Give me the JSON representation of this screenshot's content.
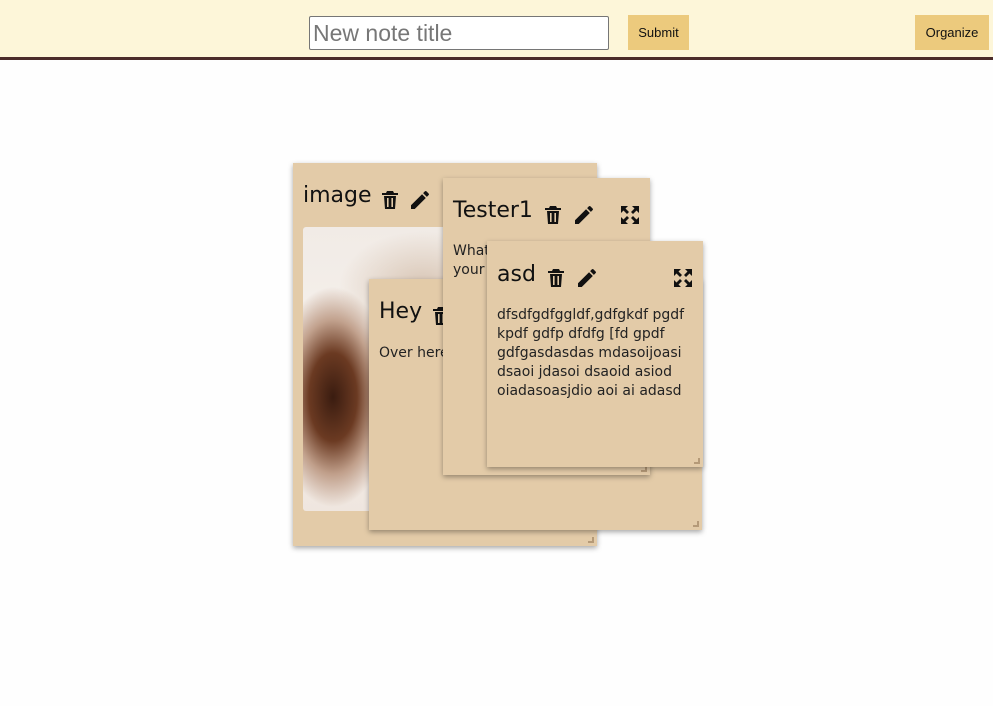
{
  "header": {
    "title_placeholder": "New note title",
    "submit_label": "Submit",
    "organize_label": "Organize"
  },
  "notes": [
    {
      "title": "image",
      "body": ""
    },
    {
      "title": "Hey",
      "body": "Over here"
    },
    {
      "title": "Tester1",
      "body": "What your"
    },
    {
      "title": "asd",
      "body": "dfsdfgdfggldf,gdfgkdf pgdf kpdf gdfp dfdfg [fd gpdf gdfgasdasdas mdasoijoasi dsaoi jdasoi dsaoid asiod oiadasoasjdio aoi ai adasd"
    }
  ],
  "icons": {
    "delete": "trash-icon",
    "edit": "pencil-icon",
    "expand": "expand-icon"
  },
  "colors": {
    "topbar_bg": "#fdf6d9",
    "topbar_border": "#4b2c2a",
    "button_bg": "#ecca7d",
    "note_bg": "#e3cba8"
  }
}
